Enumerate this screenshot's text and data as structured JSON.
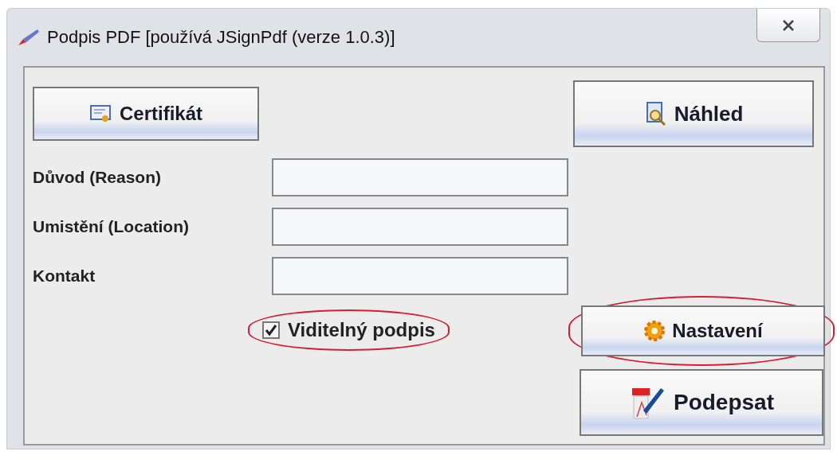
{
  "window": {
    "title": "Podpis PDF [používá JSignPdf (verze 1.0.3)]"
  },
  "buttons": {
    "certificate": "Certifikát",
    "preview": "Náhled",
    "settings": {
      "label": "Nastavení",
      "circled": true
    },
    "sign": "Podepsat"
  },
  "fields": [
    {
      "label": "Důvod (Reason)"
    },
    {
      "label": "Umistění (Location)"
    },
    {
      "label": "Kontakt"
    }
  ],
  "visible_signature": {
    "label": "Viditelný podpis",
    "checked": true,
    "circled": true
  }
}
